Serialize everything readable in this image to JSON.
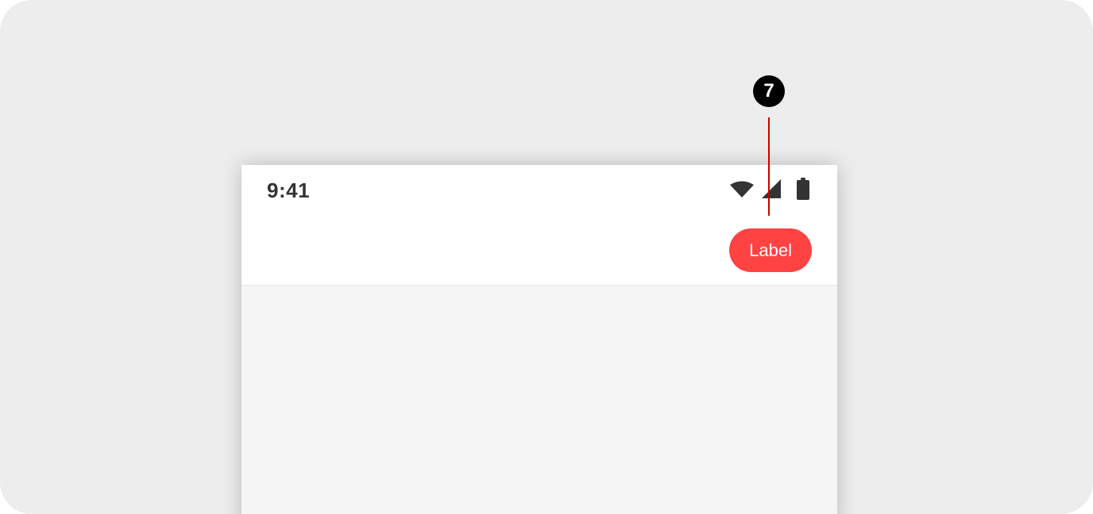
{
  "annotation": {
    "marker_number": "7",
    "marker_color": "#000000",
    "line_color": "#cc0000"
  },
  "status_bar": {
    "time": "9:41",
    "icons": [
      "wifi-icon",
      "cellular-signal-icon",
      "battery-icon"
    ]
  },
  "app_bar": {
    "action_button_label": "Label",
    "action_button_color": "#ff4242"
  },
  "colors": {
    "canvas_background": "#ededed",
    "surface": "#ffffff",
    "content_background": "#f5f5f5"
  }
}
